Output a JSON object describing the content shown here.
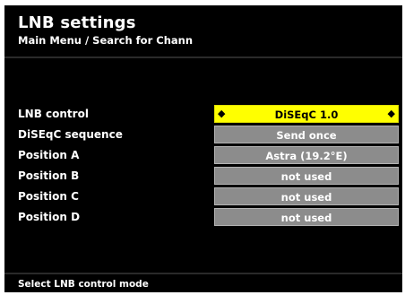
{
  "header": {
    "title": "LNB settings",
    "breadcrumb": "Main Menu / Search for Chann"
  },
  "settings": [
    {
      "label": "LNB control",
      "value": "DiSEqC 1.0",
      "selected": true
    },
    {
      "label": "DiSEqC sequence",
      "value": "Send once",
      "selected": false
    },
    {
      "label": "Position A",
      "value": "Astra (19.2°E)",
      "selected": false
    },
    {
      "label": "Position B",
      "value": "not used",
      "selected": false
    },
    {
      "label": "Position C",
      "value": "not used",
      "selected": false
    },
    {
      "label": "Position D",
      "value": "not used",
      "selected": false
    }
  ],
  "footer": {
    "help_text": "Select LNB control mode"
  },
  "colors": {
    "background": "#000000",
    "selected_value": "#ffff00",
    "value_field": "#8c8c8c",
    "text": "#ffffff"
  }
}
